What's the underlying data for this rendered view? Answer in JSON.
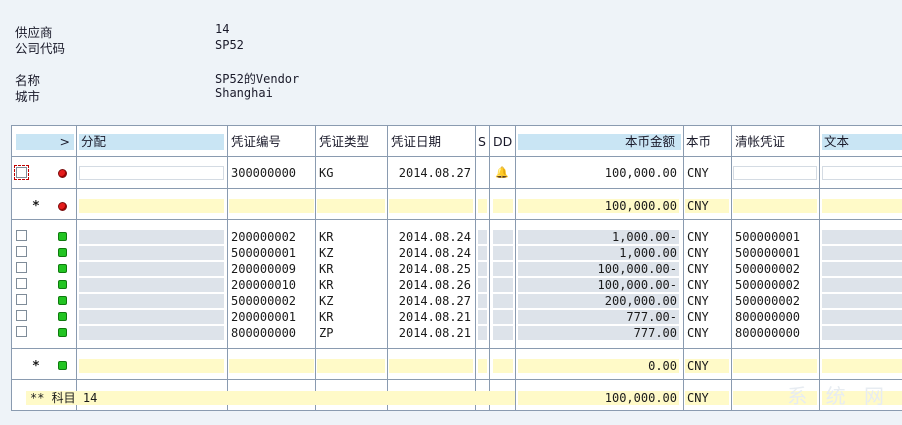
{
  "header": {
    "vendor_label": "供应商",
    "vendor_value": "14",
    "company_code_label": "公司代码",
    "company_code_value": "SP52",
    "name_label": "名称",
    "name_value": "SP52的Vendor",
    "city_label": "城市",
    "city_value": "Shanghai"
  },
  "columns": {
    "expand": ">",
    "assignment": "分配",
    "doc_number": "凭证编号",
    "doc_type": "凭证类型",
    "doc_date": "凭证日期",
    "s": "S",
    "dd": "DD",
    "amount_local": "本币金额",
    "currency": "本币",
    "clearing_doc": "清帐凭证",
    "text": "文本"
  },
  "open_items": [
    {
      "doc_number": "300000000",
      "doc_type": "KG",
      "doc_date": "2014.08.27",
      "amount": "100,000.00",
      "currency": "CNY",
      "clearing": "",
      "status": "red",
      "dunning": "bell"
    }
  ],
  "open_subtotal": {
    "marker": "*",
    "amount": "100,000.00",
    "currency": "CNY",
    "status": "red"
  },
  "cleared_items": [
    {
      "doc_number": "200000002",
      "doc_type": "KR",
      "doc_date": "2014.08.24",
      "amount": "1,000.00-",
      "currency": "CNY",
      "clearing": "500000001",
      "status": "green"
    },
    {
      "doc_number": "500000001",
      "doc_type": "KZ",
      "doc_date": "2014.08.24",
      "amount": "1,000.00",
      "currency": "CNY",
      "clearing": "500000001",
      "status": "green"
    },
    {
      "doc_number": "200000009",
      "doc_type": "KR",
      "doc_date": "2014.08.25",
      "amount": "100,000.00-",
      "currency": "CNY",
      "clearing": "500000002",
      "status": "green"
    },
    {
      "doc_number": "200000010",
      "doc_type": "KR",
      "doc_date": "2014.08.26",
      "amount": "100,000.00-",
      "currency": "CNY",
      "clearing": "500000002",
      "status": "green"
    },
    {
      "doc_number": "500000002",
      "doc_type": "KZ",
      "doc_date": "2014.08.27",
      "amount": "200,000.00",
      "currency": "CNY",
      "clearing": "500000002",
      "status": "green"
    },
    {
      "doc_number": "200000001",
      "doc_type": "KR",
      "doc_date": "2014.08.21",
      "amount": "777.00-",
      "currency": "CNY",
      "clearing": "800000000",
      "status": "green"
    },
    {
      "doc_number": "800000000",
      "doc_type": "ZP",
      "doc_date": "2014.08.21",
      "amount": "777.00",
      "currency": "CNY",
      "clearing": "800000000",
      "status": "green"
    }
  ],
  "cleared_subtotal": {
    "marker": "*",
    "amount": "0.00",
    "currency": "CNY",
    "status": "green"
  },
  "total": {
    "label": "** 科目 14",
    "amount": "100,000.00",
    "currency": "CNY"
  },
  "watermark": "系 统 网",
  "colors": {
    "header_bg": "#c9e5f4",
    "subtotal_bg": "#fffac8",
    "cell_bg": "#dde3ea",
    "grid_line": "#8a9bb0",
    "status_green": "#22c422",
    "status_red": "#e51c1c"
  }
}
